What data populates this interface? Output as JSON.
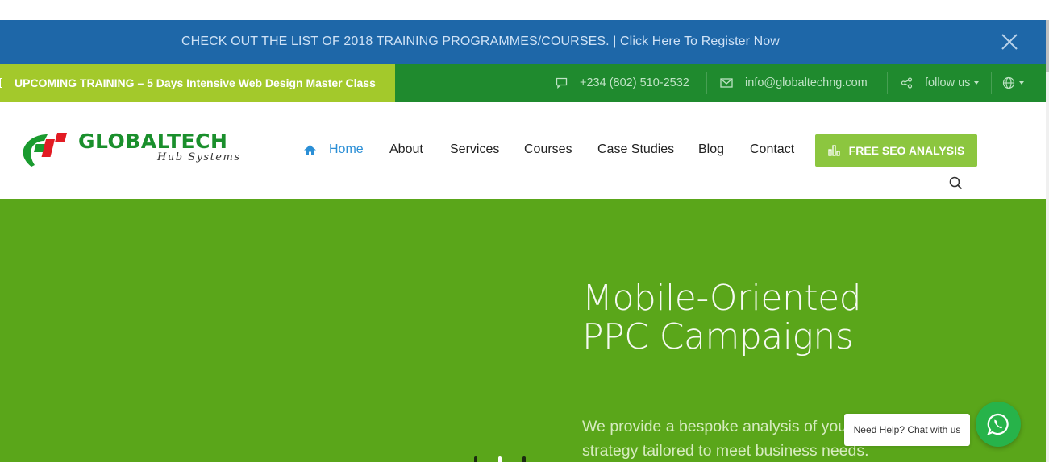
{
  "announcement": {
    "text": "CHECK OUT THE LIST OF 2018 TRAINING PROGRAMMES/COURSES. | Click Here To Register Now"
  },
  "infobar": {
    "upcoming": "UPCOMING TRAINING – 5 Days Intensive Web Design Master Class",
    "phone": "+234 (802) 510-2532",
    "email": "info@globaltechng.com",
    "follow": "follow us"
  },
  "logo": {
    "title": "GLOBALTECH",
    "subtitle": "Hub Systems"
  },
  "nav": {
    "items": [
      "Home",
      "About",
      "Services",
      "Courses",
      "Case Studies",
      "Blog",
      "Contact"
    ],
    "cta": "FREE SEO ANALYSIS"
  },
  "hero": {
    "title_line1": "Mobile-Oriented",
    "title_line2": "PPC Campaigns",
    "desc_line1": "We provide a bespoke analysis of your",
    "desc_line2": "strategy tailored to meet business needs."
  },
  "chat": {
    "tooltip": "Need Help? Chat with us"
  },
  "colors": {
    "announce_bg": "#1e67a8",
    "infobar_bg": "#1f8a2e",
    "upcoming_bg": "#a3c92b",
    "cta_bg": "#8cc63f",
    "hero_bg": "#5aa61a",
    "nav_active": "#2b8fd6",
    "whatsapp": "#27b34a"
  },
  "icons": {
    "close": "close-icon",
    "phone": "chat-bubble-icon",
    "email": "envelope-icon",
    "follow": "share-icon",
    "language": "globe-icon",
    "home": "home-icon",
    "cta": "bar-chart-icon",
    "search": "search-icon",
    "whatsapp": "whatsapp-icon"
  }
}
